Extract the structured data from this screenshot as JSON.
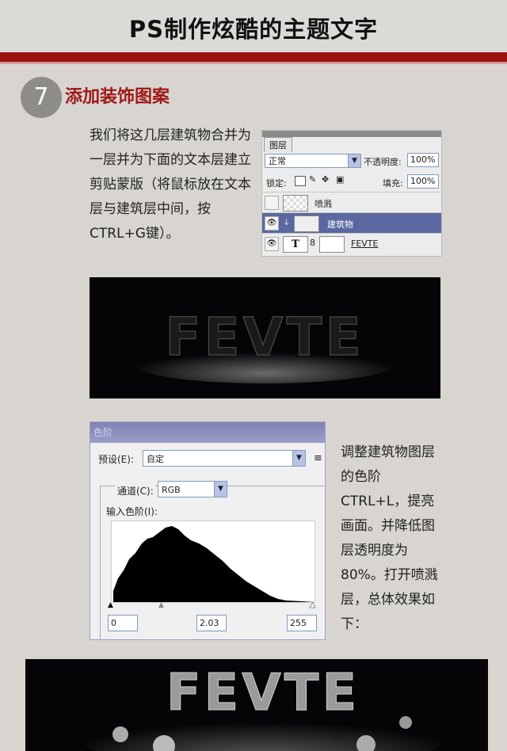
{
  "title": "PS制作炫酷的主题文字",
  "step": {
    "number": "7",
    "title": "添加装饰图案"
  },
  "paragraph1": "我们将这几层建筑物合并为一层并为下面的文本层建立剪贴蒙版（将鼠标放在文本层与建筑层中间，按CTRL+G键）。",
  "paragraph2": "调整建筑物图层的色阶CTRL+L，提亮画面。并降低图层透明度为80%。打开喷溅层，总体效果如下：",
  "layers_panel": {
    "tab": "图层",
    "blend_mode": "正常",
    "opacity_label": "不透明度:",
    "opacity_value": "100%",
    "lock_label": "锁定:",
    "fill_label": "填充:",
    "fill_value": "100%",
    "layers": [
      {
        "name": "喷溅",
        "visible": false,
        "active": false
      },
      {
        "name": "建筑物",
        "visible": true,
        "active": true
      },
      {
        "name": "FEVTE",
        "visible": true,
        "active": false,
        "type": "text"
      }
    ]
  },
  "artwork_text": "FEVTE",
  "levels_dialog": {
    "title": "色阶",
    "preset_label": "预设(E):",
    "preset_value": "自定",
    "channel_label": "通道(C):",
    "channel_value": "RGB",
    "input_label": "输入色阶(I):",
    "input_black": "0",
    "input_gamma": "2.03",
    "input_white": "255"
  },
  "colors": {
    "accent_red": "#a01818",
    "background": "#d8d5d1"
  }
}
